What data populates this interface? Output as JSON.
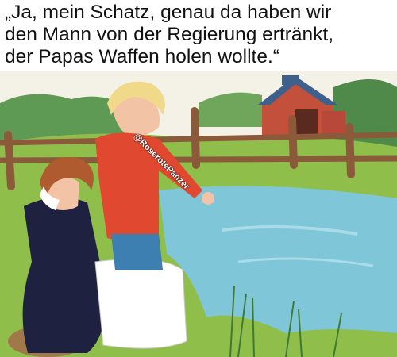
{
  "caption": {
    "line1": "„Ja, mein Schatz, genau da haben wir",
    "line2": "den Mann von der Regierung ertränkt,",
    "line3": "der Papas Waffen holen wollte.“"
  },
  "watermark": "@RoserotePanzer",
  "colors": {
    "sky": "#f4f1e6",
    "water": "#7fc6d9",
    "grass": "#8fbf4a",
    "fence": "#8a5a3a",
    "barn_roof": "#3f5f8c",
    "barn_wall": "#c2503a",
    "dress": "#1f2140",
    "apron": "#ffffff",
    "boy_shirt": "#e0492f"
  }
}
